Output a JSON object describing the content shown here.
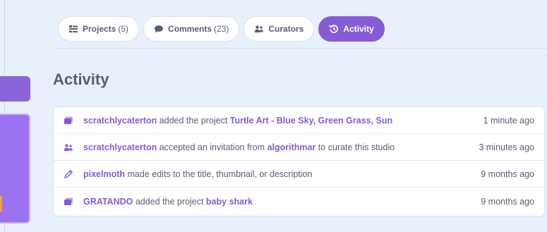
{
  "tabs": [
    {
      "label": "Projects",
      "count": "(5)",
      "icon": "projects-icon"
    },
    {
      "label": "Comments",
      "count": "(23)",
      "icon": "comment-bubble-icon"
    },
    {
      "label": "Curators",
      "count": "",
      "icon": "curators-icon"
    },
    {
      "label": "Activity",
      "count": "",
      "icon": "history-icon"
    }
  ],
  "heading": "Activity",
  "activities": [
    {
      "icon": "project-icon",
      "user": "scratchlycaterton",
      "text1": " added the project ",
      "target": "Turtle Art - Blue Sky, Green Grass, Sun",
      "text2": "",
      "time": "1 minute ago"
    },
    {
      "icon": "curators-icon",
      "user": "scratchlycaterton",
      "text1": " accepted an invitation from ",
      "target": "algorithmar",
      "text2": " to curate this studio",
      "time": "3 minutes ago"
    },
    {
      "icon": "pencil-icon",
      "user": "pixelmoth",
      "text1": " made edits to the title, thumbnail, or description",
      "target": "",
      "text2": "",
      "time": "9 months ago"
    },
    {
      "icon": "project-icon",
      "user": "GRATANDO",
      "text1": " added the project ",
      "target": "baby shark",
      "text2": "",
      "time": "9 months ago"
    }
  ],
  "colors": {
    "accent": "#855cd6",
    "text": "#575e75",
    "background": "#e8f0fb"
  }
}
